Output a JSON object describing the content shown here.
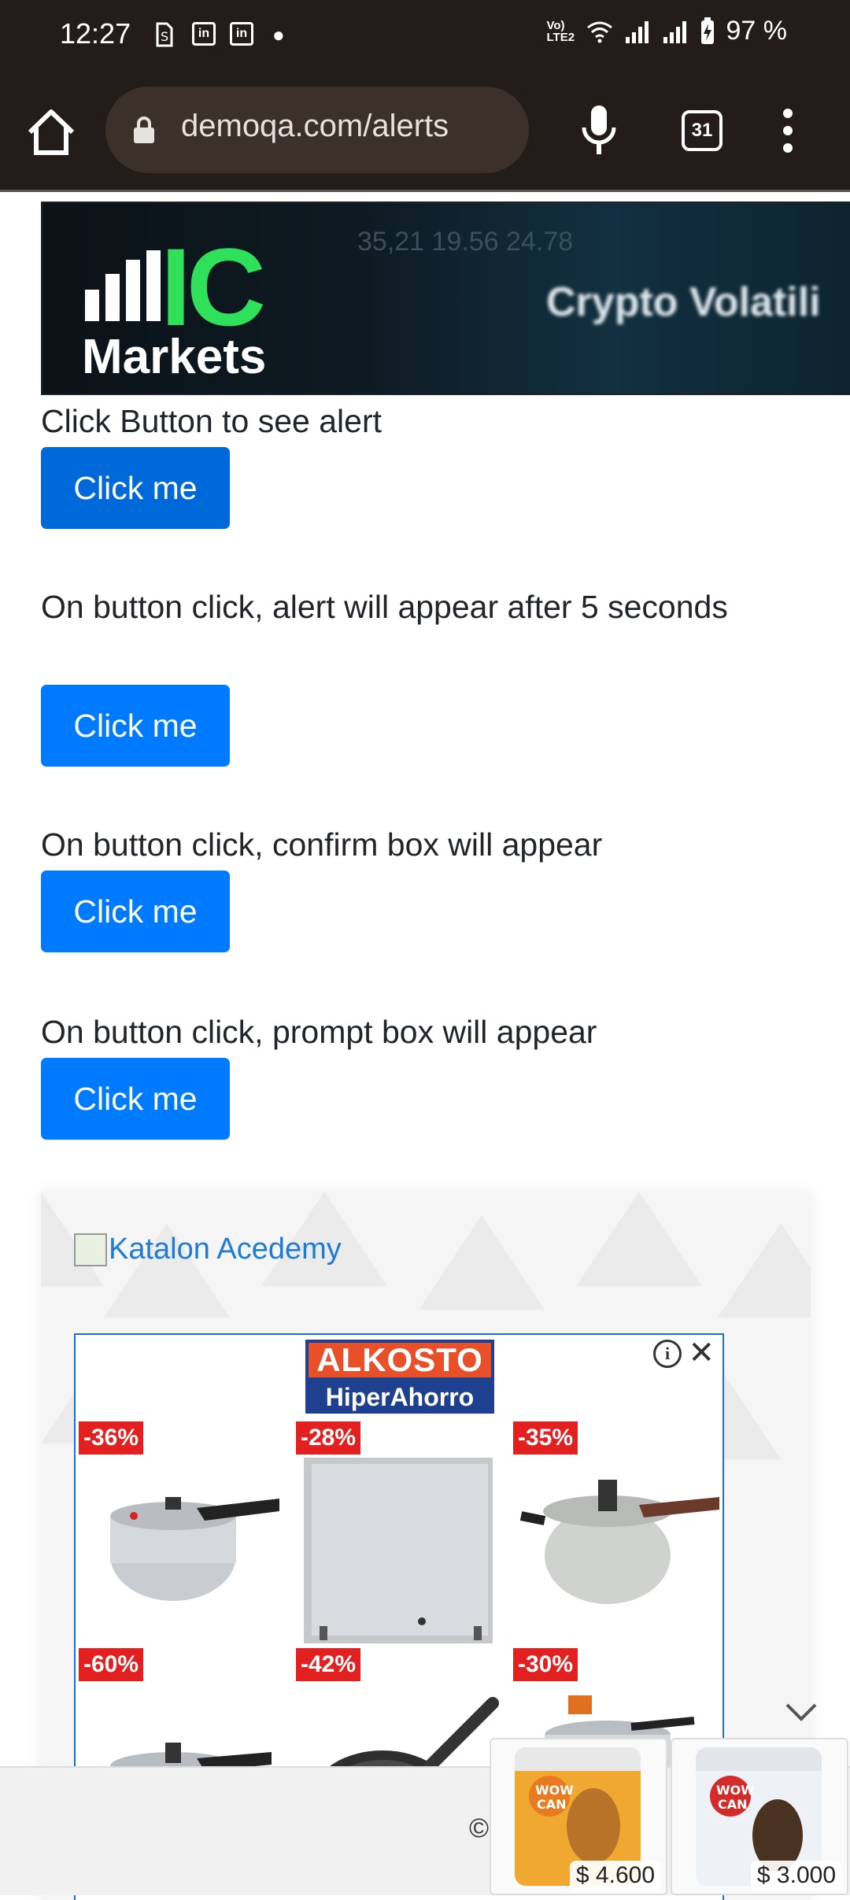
{
  "status_bar": {
    "time": "12:27",
    "battery": "97 %",
    "left_icons": [
      "sim-icon",
      "linkedin-icon",
      "linkedin-icon",
      "dot-icon"
    ],
    "right_icons": [
      "volte-icon",
      "wifi-icon",
      "signal-icon",
      "signal-icon",
      "battery-charging-icon"
    ],
    "volte_label": "Vo) LTE2"
  },
  "browser": {
    "url": "demoqa.com/alerts",
    "tab_count": "31"
  },
  "banner_ad": {
    "brand_ic": "IC",
    "brand_markets": "Markets",
    "tagline": "Crypto Volatili",
    "deco_numbers": "35,21  19.56  24.78"
  },
  "alerts": [
    {
      "label": "Click Button to see alert",
      "button": "Click me"
    },
    {
      "label": "On button click, alert will appear after 5 seconds",
      "button": "Click me"
    },
    {
      "label": "On button click, confirm box will appear",
      "button": "Click me"
    },
    {
      "label": "On button click, prompt box will appear",
      "button": "Click me"
    }
  ],
  "ad_section": {
    "katalon_link": "Katalon Acedemy",
    "alkosto_top": "ALKOSTO",
    "alkosto_bottom": "HiperAhorro",
    "info_icon": "i",
    "close_icon": "✕",
    "products": [
      {
        "discount": "-36%",
        "item": "pressure-cooker"
      },
      {
        "discount": "-28%",
        "item": "mini-fridge"
      },
      {
        "discount": "-35%",
        "item": "pressure-cooker"
      },
      {
        "discount": "-60%",
        "item": "pressure-cooker"
      },
      {
        "discount": "-42%",
        "item": "frying-pan"
      },
      {
        "discount": "-30%",
        "item": "pressure-cooker"
      }
    ]
  },
  "footer": {
    "copyright": "©"
  },
  "shopping_ads": [
    {
      "price": "$ 4.600",
      "brand": "WOW CAN"
    },
    {
      "price": "$ 3.000",
      "brand": "WOW CAN"
    }
  ]
}
